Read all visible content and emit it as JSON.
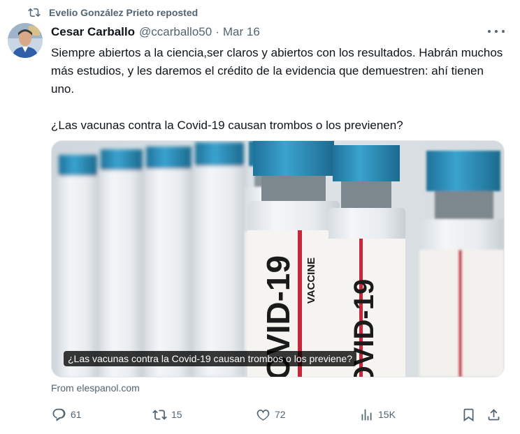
{
  "repost": {
    "text": "Evelio González Prieto reposted",
    "icon": "repost-icon"
  },
  "author": {
    "display_name": "Cesar Carballo",
    "handle": "@ccarballo50",
    "separator": "·",
    "date": "Mar 16"
  },
  "tweet": {
    "paragraph1": "Siempre abiertos a la ciencia,ser claros y abiertos con los resultados. Habrán muchos más estudios, y les daremos el crédito de la evidencia que demuestren: ahí tienen uno.",
    "paragraph2": "¿Las vacunas contra la Covid-19 causan trombos o los previenen?"
  },
  "card": {
    "caption": "¿Las vacunas contra la Covid-19 causan trombos o los previene?",
    "vial_label": "COVID-19",
    "vial_sublabel": "VACCINE"
  },
  "source": "From elespanol.com",
  "actions": {
    "reply_count": "61",
    "repost_count": "15",
    "like_count": "72",
    "views_count": "15K"
  },
  "colors": {
    "text_primary": "#0f1419",
    "text_secondary": "#536471",
    "vial_cap": "#2b8fb8",
    "label_red": "#c8283c"
  }
}
